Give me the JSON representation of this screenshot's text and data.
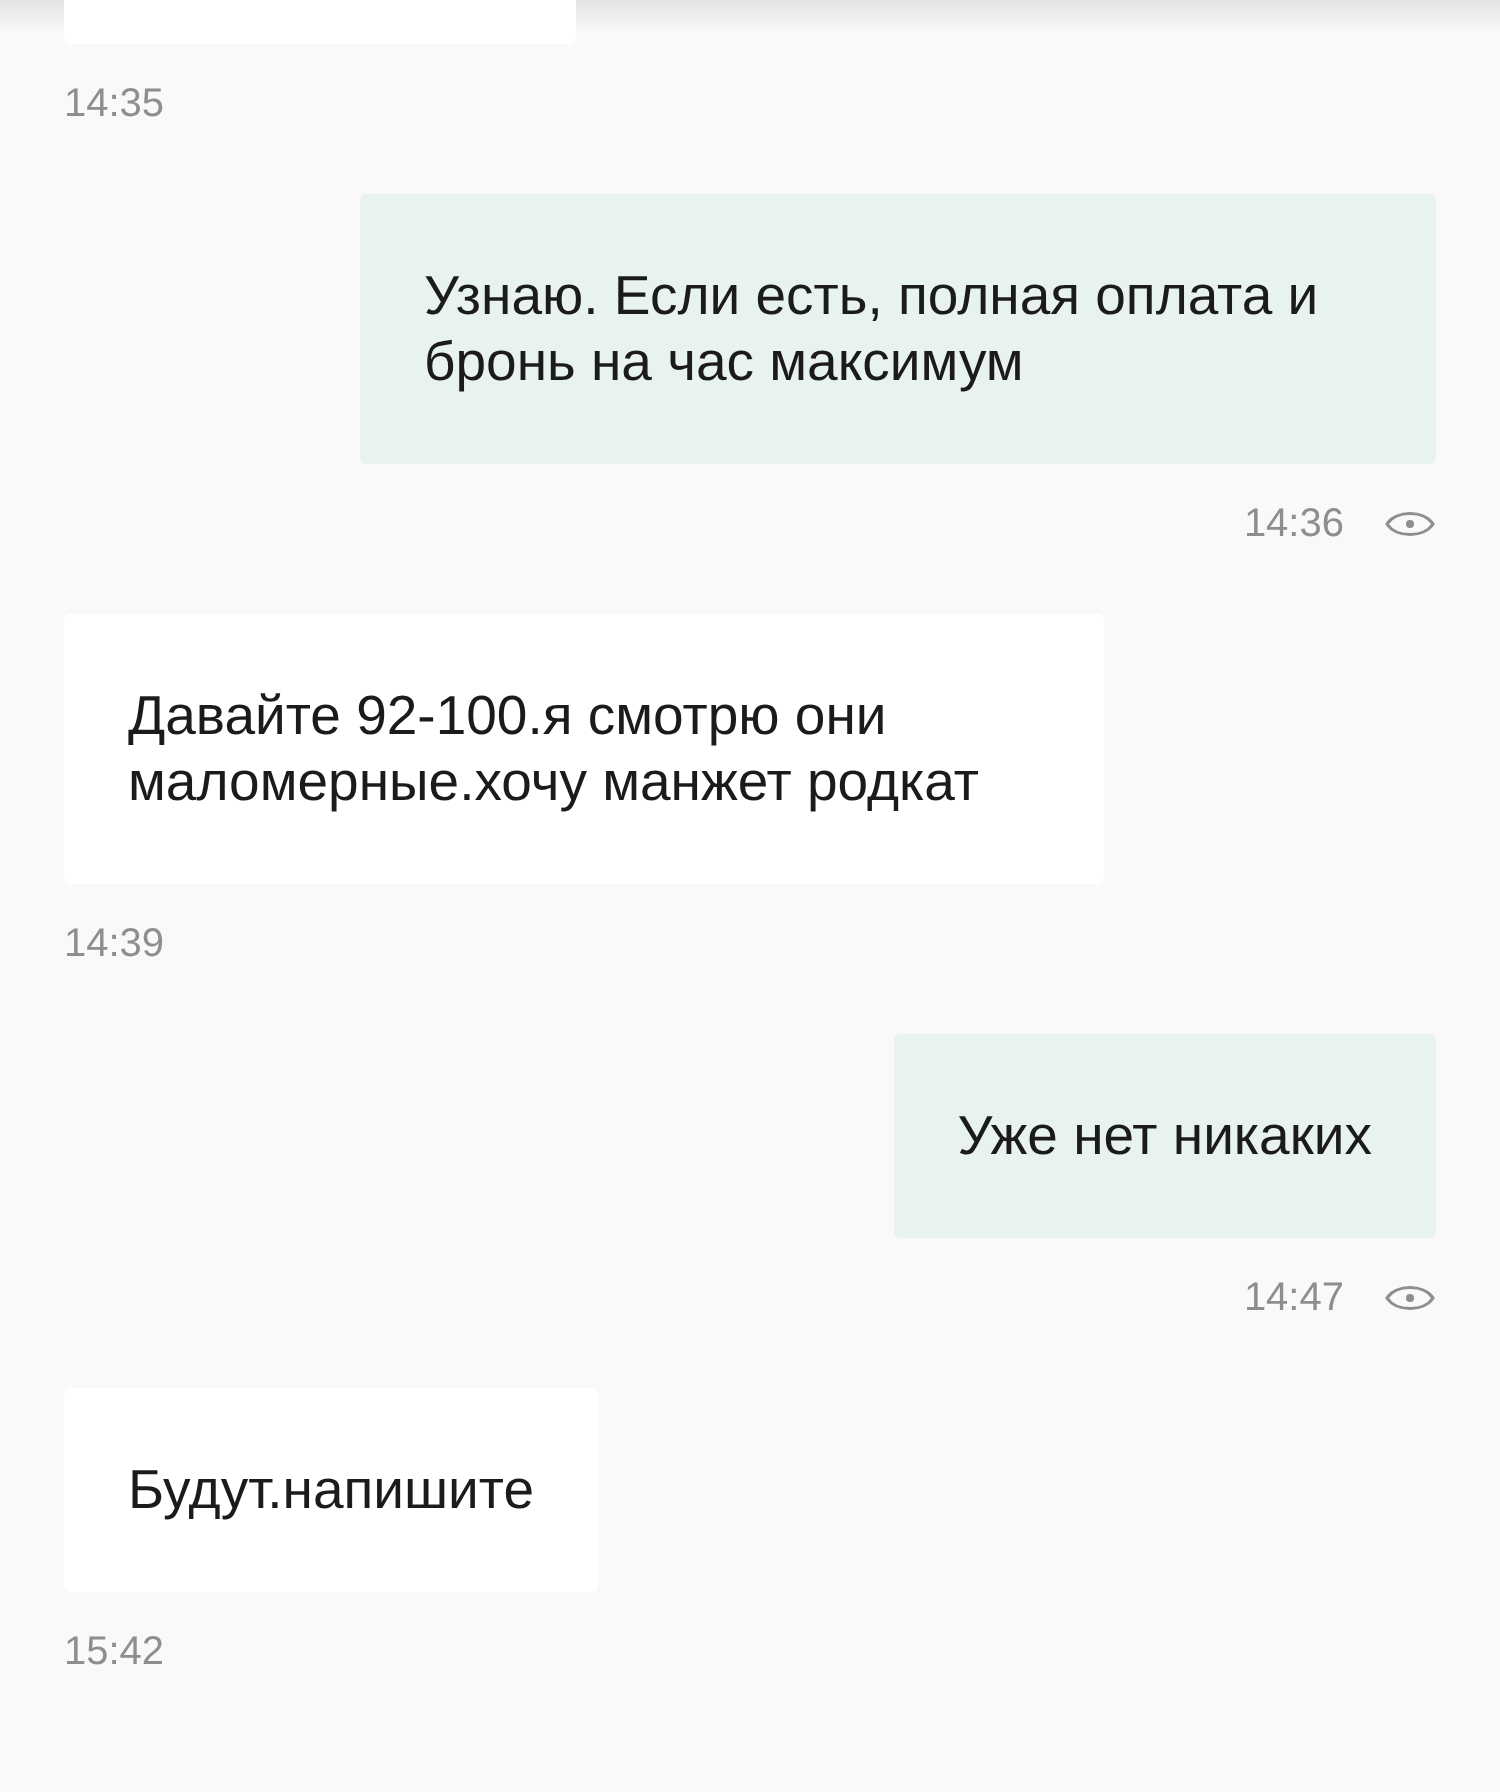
{
  "messages": [
    {
      "outgoing": false,
      "kind": "cut",
      "time": "14:35",
      "seen": false
    },
    {
      "outgoing": true,
      "kind": "text",
      "text": "Узнаю. Если есть, полная оплата и бронь на час максимум",
      "time": "14:36",
      "seen": true
    },
    {
      "outgoing": false,
      "kind": "text",
      "text": "Давайте 92-100.я смотрю они маломерные.хочу манжет родкат",
      "time": "14:39",
      "seen": false
    },
    {
      "outgoing": true,
      "kind": "text",
      "text": "Уже нет никаких",
      "time": "14:47",
      "seen": true
    },
    {
      "outgoing": false,
      "kind": "text",
      "text": "Будут.напишите",
      "time": "15:42",
      "seen": false
    }
  ]
}
